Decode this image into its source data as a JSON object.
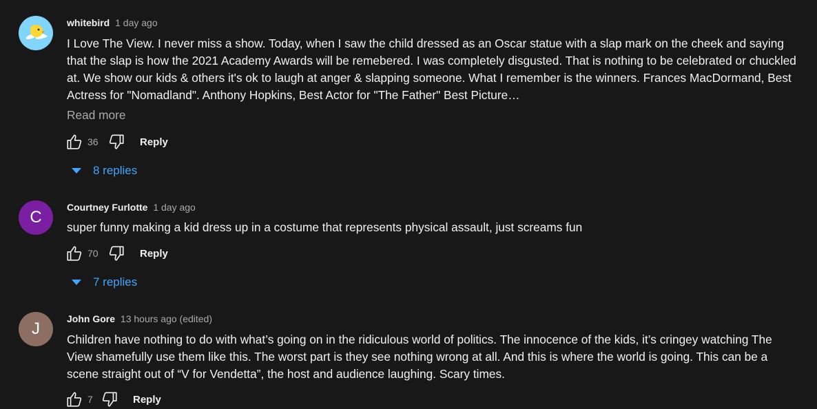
{
  "comments": [
    {
      "author": "whitebird",
      "time": "1 day ago",
      "text": "I Love The View. I never miss a show. Today, when I saw the child dressed as an Oscar statue with a slap mark on the cheek and saying that the slap is how the  2021 Academy Awards will be remebered. I was completely disgusted. That is nothing to be celebrated or chuckled at. We show our kids & others it's ok to laugh at anger & slapping someone. What I remember is the winners. Frances MacDormand, Best Actress for \"Nomadland\". Anthony Hopkins, Best Actor for \"The Father\" Best Picture…",
      "read_more": "Read more",
      "likes": "36",
      "reply_label": "Reply",
      "replies_label": "8 replies",
      "avatar_icon": "bird-avatar-icon"
    },
    {
      "author": "Courtney Furlotte",
      "time": "1 day ago",
      "text": "super funny making a kid dress up in a costume that represents physical assault, just screams fun",
      "likes": "70",
      "reply_label": "Reply",
      "replies_label": "7 replies",
      "avatar_letter": "C",
      "avatar_color": "#7b1fa2"
    },
    {
      "author": "John Gore",
      "time": "13 hours ago (edited)",
      "text": "Children have nothing to do with what’s going on in the ridiculous world of politics. The innocence of the kids, it’s cringey watching The View shamefully use them like this. The worst part is they see nothing wrong at all. And this is where the world is going. This can be a scene straight out of “V for Vendetta”, the host and audience laughing. Scary times.",
      "likes": "7",
      "reply_label": "Reply",
      "avatar_letter": "J",
      "avatar_color": "#8d6e63"
    }
  ]
}
